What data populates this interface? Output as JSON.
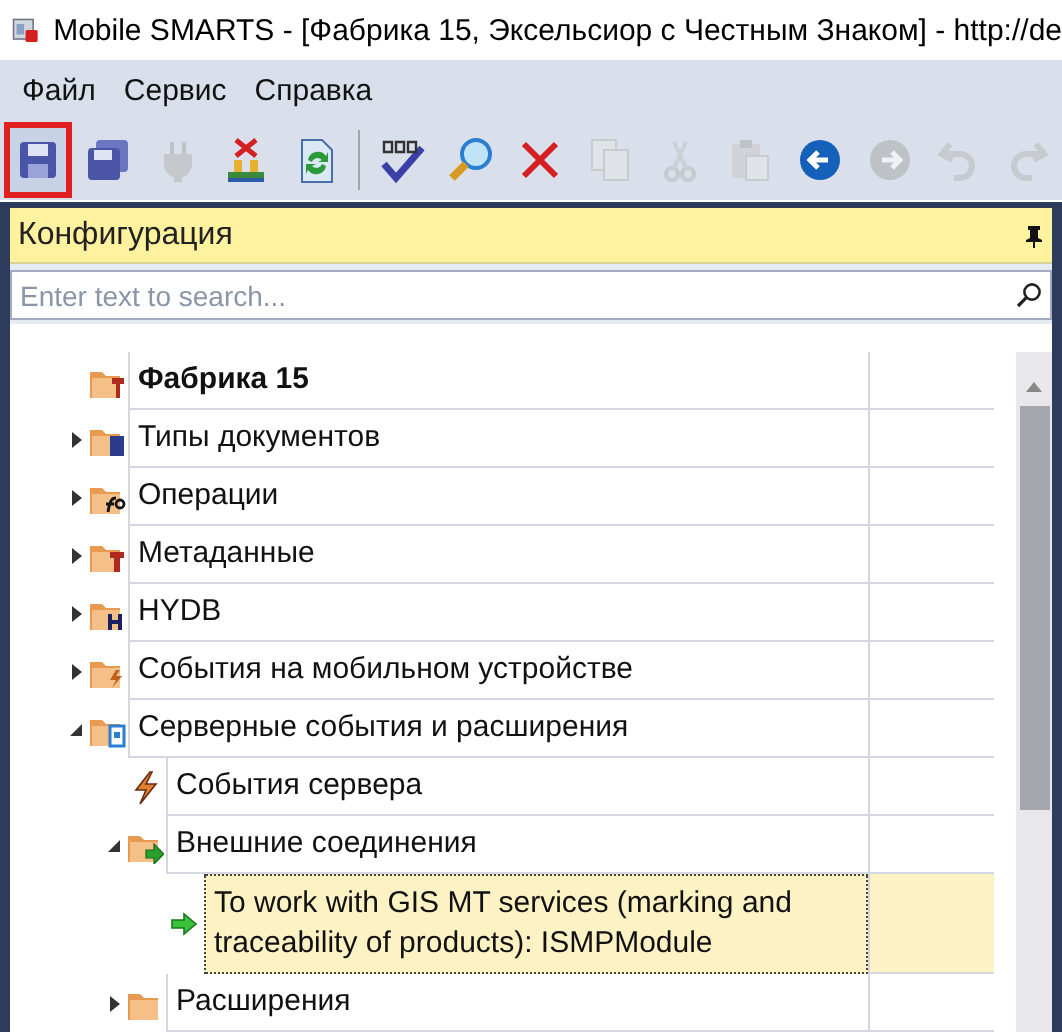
{
  "window": {
    "title": "Mobile SMARTS - [Фабрика 15, Эксельсиор с Честным Знаком] - http://de"
  },
  "menu": [
    "Файл",
    "Сервис",
    "Справка"
  ],
  "toolbar": [
    {
      "kind": "save",
      "disabled": false,
      "highlighted": true
    },
    {
      "kind": "save-all",
      "disabled": false,
      "highlighted": false
    },
    {
      "kind": "plug",
      "disabled": true,
      "highlighted": false
    },
    {
      "kind": "unload",
      "disabled": false,
      "highlighted": false
    },
    {
      "kind": "refresh",
      "disabled": false,
      "highlighted": false
    },
    {
      "kind": "separator"
    },
    {
      "kind": "spellcheck",
      "disabled": false,
      "highlighted": false
    },
    {
      "kind": "search",
      "disabled": false,
      "highlighted": false
    },
    {
      "kind": "delete",
      "disabled": false,
      "highlighted": false
    },
    {
      "kind": "copy",
      "disabled": true,
      "highlighted": false
    },
    {
      "kind": "cut",
      "disabled": true,
      "highlighted": false
    },
    {
      "kind": "paste",
      "disabled": true,
      "highlighted": false
    },
    {
      "kind": "back",
      "disabled": false,
      "highlighted": false
    },
    {
      "kind": "forward",
      "disabled": true,
      "highlighted": false
    },
    {
      "kind": "undo",
      "disabled": true,
      "highlighted": false
    },
    {
      "kind": "redo",
      "disabled": true,
      "highlighted": false
    }
  ],
  "panel": {
    "title": "Конфигурация",
    "search": {
      "placeholder": "Enter text to search..."
    },
    "tree": [
      {
        "label": "Фабрика 15",
        "kind": "project",
        "selected": false
      },
      {
        "label": "Типы документов",
        "kind": "doc-types",
        "expanded": false,
        "selected": false
      },
      {
        "label": "Операции",
        "kind": "operations",
        "expanded": false,
        "selected": false
      },
      {
        "label": "Метаданные",
        "kind": "metadata",
        "expanded": false,
        "selected": false
      },
      {
        "label": "HYDB",
        "kind": "database",
        "expanded": false,
        "selected": false
      },
      {
        "label": "События на мобильном устройстве",
        "kind": "mobile-events",
        "expanded": false,
        "selected": false
      },
      {
        "label": "Серверные события и расширения",
        "kind": "server-events",
        "expanded": true,
        "selected": false,
        "children": [
          {
            "label": "События сервера",
            "kind": "event",
            "selected": false
          },
          {
            "label": "Внешние соединения",
            "kind": "connections",
            "expanded": true,
            "selected": false,
            "children": [
              {
                "label": "To work with GIS MT services (marking and traceability of products): ISMPModule",
                "kind": "connection",
                "selected": true
              }
            ]
          },
          {
            "label": "Расширения",
            "kind": "extensions",
            "expanded": false,
            "selected": false
          }
        ]
      }
    ]
  }
}
